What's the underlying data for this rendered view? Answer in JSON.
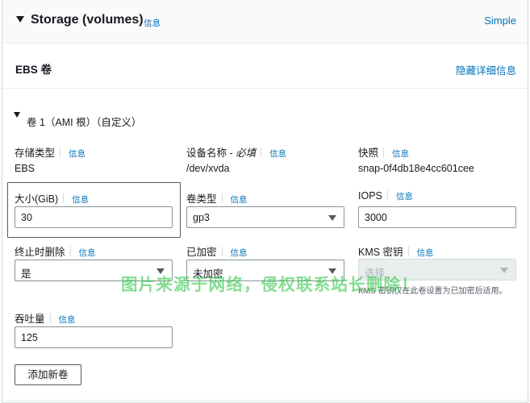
{
  "panel": {
    "title": "Storage (volumes)",
    "info": "信息",
    "mode_link": "Simple"
  },
  "ebs": {
    "title": "EBS 卷",
    "hide_details": "隐藏详细信息"
  },
  "volume": {
    "title": "卷 1（AMI 根）（自定义）",
    "storage_type": {
      "label": "存储类型",
      "info": "信息",
      "value": "EBS"
    },
    "device_name": {
      "label": "设备名称 - ",
      "required": "必填",
      "info": "信息",
      "value": "/dev/xvda"
    },
    "snapshot": {
      "label": "快照",
      "info": "信息",
      "value": "snap-0f4db18e4cc601cee"
    },
    "size": {
      "label": "大小(GiB)",
      "info": "信息",
      "value": "30"
    },
    "volume_type": {
      "label": "卷类型",
      "info": "信息",
      "value": "gp3"
    },
    "iops": {
      "label": "IOPS",
      "info": "信息",
      "value": "3000"
    },
    "delete_on_termination": {
      "label": "终止时删除",
      "info": "信息",
      "value": "是"
    },
    "encrypted": {
      "label": "已加密",
      "info": "信息",
      "value": "未加密"
    },
    "kms_key": {
      "label": "KMS 密钥",
      "info": "信息",
      "placeholder": "选择",
      "hint": "KMS 密钥仅在此卷设置为已加密后适用。"
    },
    "throughput": {
      "label": "吞吐量",
      "info": "信息",
      "value": "125"
    }
  },
  "add_volume_button": "添加新卷",
  "watermark": "图片来源于网络，侵权联系站长删除！"
}
